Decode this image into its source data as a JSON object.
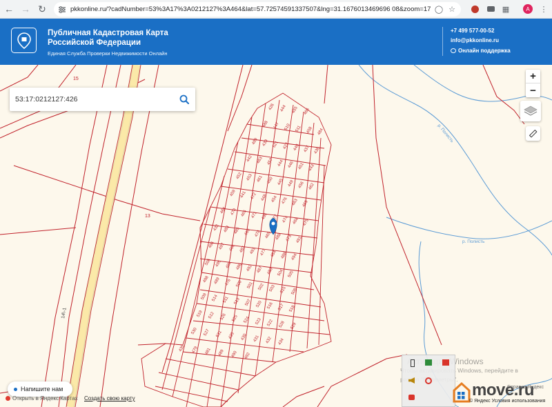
{
  "browser": {
    "url": "pkkonline.ru/?cadNumber=53%3A17%3A0212127%3A464&lat=57.72574591337507&lng=31.1676013469696 08&zoom=17",
    "profile_initial": "A"
  },
  "header": {
    "title_line1": "Публичная Кадастровая Карта",
    "title_line2": "Российской Федерации",
    "subtitle": "Единая Служба Проверки Недвижимости Онлайн",
    "phone": "+7 499 577-00-52",
    "email": "info@pkkonline.ru",
    "support": "Онлайн поддержка",
    "accent_color": "#1a6fc5"
  },
  "search": {
    "value": "53:17:0212127:426",
    "icon": "search-icon"
  },
  "map_controls": {
    "zoom_in": "+",
    "zoom_out": "−",
    "layers_icon": "layers-icon",
    "ruler_icon": "ruler-icon"
  },
  "map_labels": {
    "lot_15": "15",
    "lot_13": "13",
    "road_141": "14\\-1",
    "stream_1": "р. Полисть",
    "stream_2": "р. Полисть"
  },
  "parcels": [
    "426",
    "444",
    "455",
    "466",
    "488",
    "447",
    "510",
    "511",
    "458",
    "484",
    "499",
    "439",
    "521",
    "427",
    "440",
    "437",
    "436",
    "442",
    "463",
    "457",
    "444",
    "446",
    "451",
    "443",
    "452",
    "453",
    "461",
    "450",
    "445",
    "449",
    "456",
    "462",
    "459",
    "441",
    "472",
    "448",
    "454",
    "476",
    "463",
    "469",
    "464",
    "470",
    "465",
    "471",
    "496",
    "477",
    "474",
    "468",
    "475",
    "432",
    "483",
    "485",
    "460",
    "478",
    "465",
    "488",
    "473",
    "491",
    "496",
    "497",
    "486",
    "482",
    "493",
    "477",
    "484",
    "488",
    "494",
    "506",
    "495",
    "490",
    "486",
    "492",
    "487",
    "480",
    "504",
    "505",
    "498",
    "489",
    "476",
    "500",
    "501",
    "502",
    "503",
    "515",
    "508",
    "509",
    "514",
    "511",
    "513",
    "507",
    "520",
    "516",
    "517",
    "518",
    "519",
    "512",
    "526",
    "525",
    "524",
    "523",
    "522",
    "528",
    "529",
    "530",
    "527",
    "531",
    "433",
    "430",
    "431",
    "432",
    "434",
    "435",
    "479",
    "481",
    "489",
    "490",
    "492"
  ],
  "widgets": {
    "chat_label": "Напишите нам",
    "report_link": "Открыть в Яндекс Картах",
    "create_map": "Создать свою карту",
    "yandex_copy": "© Яндекс Условия использования",
    "yandex_logo_text": "Справка Яндекс"
  },
  "windows_watermark": {
    "line1": "Активация Windows",
    "line2": "Чтобы активировать Windows, перейдите в",
    "line3": "раздел \"Параметры\"."
  },
  "brand_watermark": "move.ru"
}
